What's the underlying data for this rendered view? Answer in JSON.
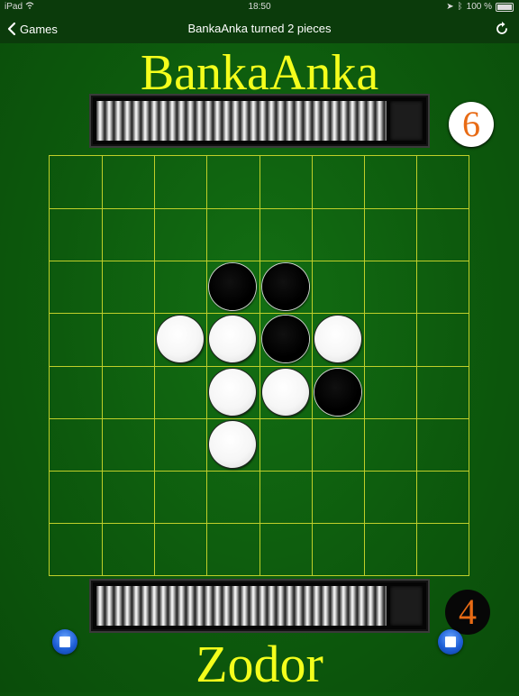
{
  "status_bar": {
    "device": "iPad",
    "time": "18:50",
    "battery": "100 %"
  },
  "nav": {
    "back_label": "Games",
    "title": "BankaAnka turned 2 pieces",
    "refresh_icon": "refresh-icon"
  },
  "players": {
    "top": {
      "name": "BankaAnka",
      "score": "6",
      "color": "white"
    },
    "bottom": {
      "name": "Zodor",
      "score": "4",
      "color": "black"
    }
  },
  "board": {
    "size": 8,
    "line_color": "#bfcf2a",
    "background": "#0f620f",
    "pieces": [
      {
        "row": 2,
        "col": 3,
        "color": "black"
      },
      {
        "row": 2,
        "col": 4,
        "color": "black"
      },
      {
        "row": 3,
        "col": 2,
        "color": "white"
      },
      {
        "row": 3,
        "col": 3,
        "color": "white"
      },
      {
        "row": 3,
        "col": 4,
        "color": "black"
      },
      {
        "row": 3,
        "col": 5,
        "color": "white"
      },
      {
        "row": 4,
        "col": 3,
        "color": "white"
      },
      {
        "row": 4,
        "col": 4,
        "color": "white"
      },
      {
        "row": 4,
        "col": 5,
        "color": "black"
      },
      {
        "row": 5,
        "col": 3,
        "color": "white"
      }
    ]
  },
  "colors": {
    "name_yellow": "#f4ff1c",
    "score_orange": "#e86b15",
    "stop_blue": "#1e5fd6"
  }
}
